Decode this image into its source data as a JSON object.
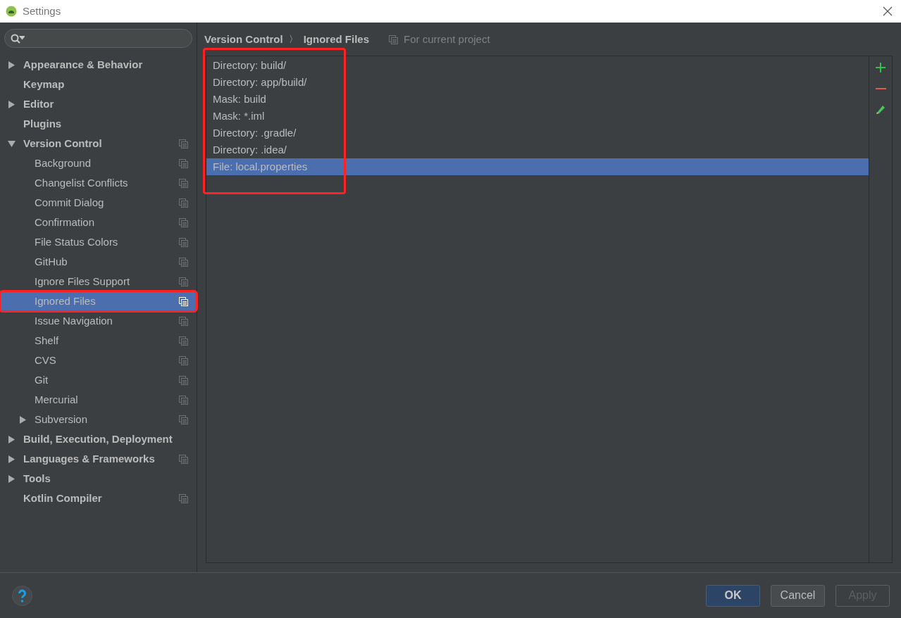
{
  "window": {
    "title": "Settings"
  },
  "sidebar": {
    "items": [
      {
        "label": "Appearance & Behavior",
        "kind": "folder",
        "expanded": false,
        "selected": false,
        "project_scope": false,
        "marked": false
      },
      {
        "label": "Keymap",
        "kind": "page",
        "selected": false,
        "project_scope": false,
        "marked": false
      },
      {
        "label": "Editor",
        "kind": "folder",
        "expanded": false,
        "selected": false,
        "project_scope": false,
        "marked": false
      },
      {
        "label": "Plugins",
        "kind": "page",
        "selected": false,
        "project_scope": false,
        "marked": false
      },
      {
        "label": "Version Control",
        "kind": "folder",
        "expanded": true,
        "selected": false,
        "project_scope": true,
        "marked": false,
        "children": [
          {
            "label": "Background",
            "kind": "page",
            "selected": false,
            "project_scope": true,
            "marked": false
          },
          {
            "label": "Changelist Conflicts",
            "kind": "page",
            "selected": false,
            "project_scope": true,
            "marked": false
          },
          {
            "label": "Commit Dialog",
            "kind": "page",
            "selected": false,
            "project_scope": true,
            "marked": false
          },
          {
            "label": "Confirmation",
            "kind": "page",
            "selected": false,
            "project_scope": true,
            "marked": false
          },
          {
            "label": "File Status Colors",
            "kind": "page",
            "selected": false,
            "project_scope": true,
            "marked": false
          },
          {
            "label": "GitHub",
            "kind": "page",
            "selected": false,
            "project_scope": true,
            "marked": false
          },
          {
            "label": "Ignore Files Support",
            "kind": "page",
            "selected": false,
            "project_scope": true,
            "marked": false
          },
          {
            "label": "Ignored Files",
            "kind": "page",
            "selected": true,
            "project_scope": true,
            "marked": true
          },
          {
            "label": "Issue Navigation",
            "kind": "page",
            "selected": false,
            "project_scope": true,
            "marked": false
          },
          {
            "label": "Shelf",
            "kind": "page",
            "selected": false,
            "project_scope": true,
            "marked": false
          },
          {
            "label": "CVS",
            "kind": "page",
            "selected": false,
            "project_scope": true,
            "marked": false
          },
          {
            "label": "Git",
            "kind": "page",
            "selected": false,
            "project_scope": true,
            "marked": false
          },
          {
            "label": "Mercurial",
            "kind": "page",
            "selected": false,
            "project_scope": true,
            "marked": false
          },
          {
            "label": "Subversion",
            "kind": "folder",
            "expanded": false,
            "selected": false,
            "project_scope": true,
            "marked": false
          }
        ]
      },
      {
        "label": "Build, Execution, Deployment",
        "kind": "folder",
        "expanded": false,
        "selected": false,
        "project_scope": false,
        "marked": false
      },
      {
        "label": "Languages & Frameworks",
        "kind": "folder",
        "expanded": false,
        "selected": false,
        "project_scope": true,
        "marked": false
      },
      {
        "label": "Tools",
        "kind": "folder",
        "expanded": false,
        "selected": false,
        "project_scope": false,
        "marked": false
      },
      {
        "label": "Kotlin Compiler",
        "kind": "page",
        "selected": false,
        "project_scope": true,
        "marked": false
      }
    ]
  },
  "header": {
    "breadcrumb": [
      "Version Control",
      "Ignored Files"
    ],
    "separator": "〉",
    "scope": "For current project"
  },
  "ignored_list": {
    "marked": true,
    "items": [
      {
        "label": "Directory: build/",
        "selected": false
      },
      {
        "label": "Directory: app/build/",
        "selected": false
      },
      {
        "label": "Mask: build",
        "selected": false
      },
      {
        "label": "Mask: *.iml",
        "selected": false
      },
      {
        "label": "Directory: .gradle/",
        "selected": false
      },
      {
        "label": "Directory: .idea/",
        "selected": false
      },
      {
        "label": "File: local.properties",
        "selected": true
      }
    ]
  },
  "buttons": [
    {
      "label": "OK",
      "kind": "default",
      "disabled": false
    },
    {
      "label": "Cancel",
      "kind": "normal",
      "disabled": false
    },
    {
      "label": "Apply",
      "kind": "normal",
      "disabled": true
    }
  ]
}
